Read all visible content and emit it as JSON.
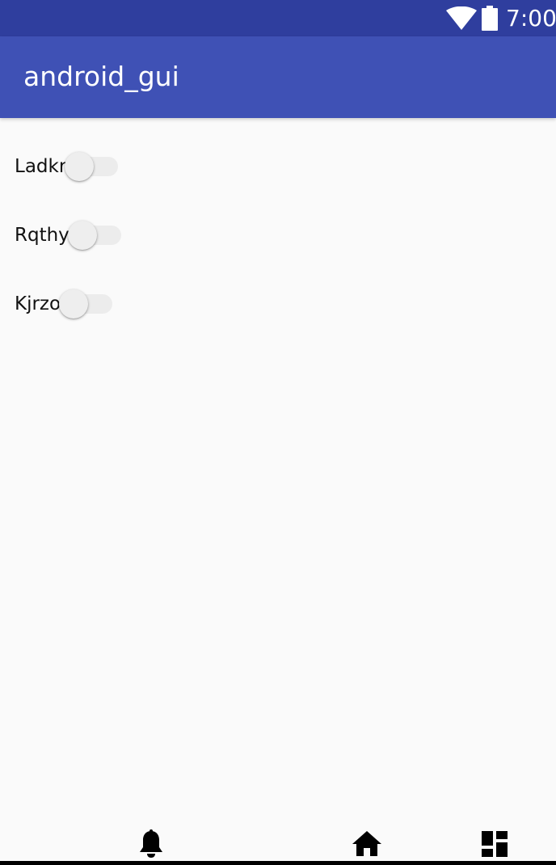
{
  "status_bar": {
    "time": "7:00",
    "icons": [
      "wifi-icon",
      "battery-icon"
    ],
    "color": "#2f3e9e"
  },
  "app_bar": {
    "title": "android_gui",
    "color": "#3f51b5"
  },
  "switches": [
    {
      "label": "Ladkr",
      "checked": false
    },
    {
      "label": "Rqthy",
      "checked": false
    },
    {
      "label": "Kjrzo",
      "checked": false
    }
  ],
  "nav_bar": {
    "icons": [
      "bell-icon",
      "home-icon",
      "dashboard-icon"
    ]
  }
}
